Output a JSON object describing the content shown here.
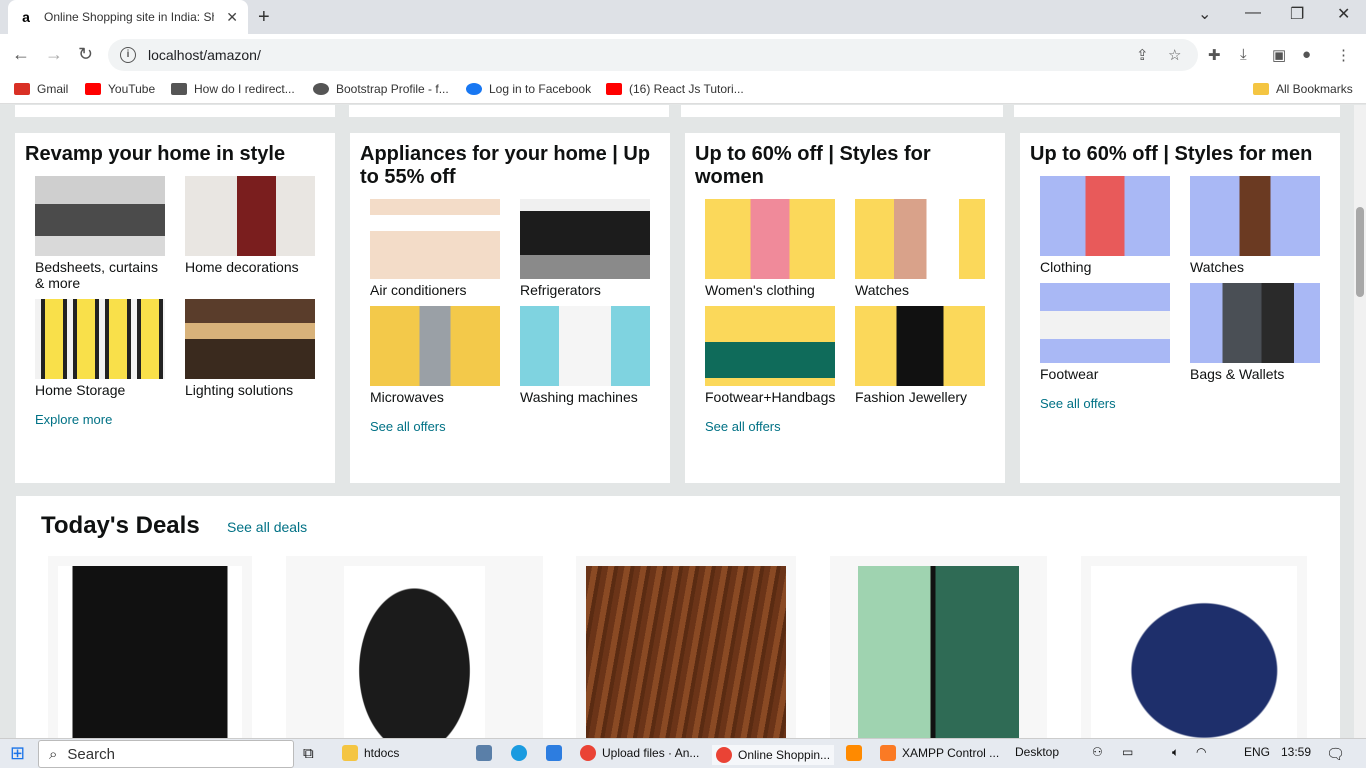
{
  "browser": {
    "tab_title": "Online Shopping site in India: Sh",
    "url": "localhost/amazon/",
    "bookmarks": [
      {
        "label": "Gmail",
        "color": "#d93025"
      },
      {
        "label": "YouTube",
        "color": "#ff0000"
      },
      {
        "label": "How do I redirect...",
        "color": "#555555"
      },
      {
        "label": "Bootstrap Profile - f...",
        "color": "#555555"
      },
      {
        "label": "Log in to Facebook",
        "color": "#1877f2"
      },
      {
        "label": "(16) React Js Tutori...",
        "color": "#ff0000"
      }
    ],
    "all_bookmarks": "All Bookmarks"
  },
  "cards": [
    {
      "title": "Revamp your home in style",
      "items": [
        {
          "label": "Bedsheets, curtains & more"
        },
        {
          "label": "Home decorations"
        },
        {
          "label": "Home Storage"
        },
        {
          "label": "Lighting solutions"
        }
      ],
      "link": "Explore more"
    },
    {
      "title": "Appliances for your home | Up to 55% off",
      "items": [
        {
          "label": "Air conditioners"
        },
        {
          "label": "Refrigerators"
        },
        {
          "label": "Microwaves"
        },
        {
          "label": "Washing machines"
        }
      ],
      "link": "See all offers"
    },
    {
      "title": "Up to 60% off | Styles for women",
      "items": [
        {
          "label": "Women's clothing"
        },
        {
          "label": "Watches"
        },
        {
          "label": "Footwear+Handbags"
        },
        {
          "label": "Fashion Jewellery"
        }
      ],
      "link": "See all offers"
    },
    {
      "title": "Up to 60% off | Styles for men",
      "items": [
        {
          "label": "Clothing"
        },
        {
          "label": "Watches"
        },
        {
          "label": "Footwear"
        },
        {
          "label": "Bags & Wallets"
        }
      ],
      "link": "See all offers"
    }
  ],
  "deals": {
    "title": "Today's Deals",
    "see_all": "See all deals",
    "images": [
      "water-purifier",
      "travel-adapter",
      "wood-sheet",
      "smartphone",
      "flip-flop"
    ]
  },
  "taskbar": {
    "search": "Search",
    "items": [
      "htdocs",
      "Upload files · An...",
      "Online Shoppin...",
      "XAMPP Control ...",
      "Desktop"
    ],
    "lang": "ENG",
    "time": "13:59"
  }
}
